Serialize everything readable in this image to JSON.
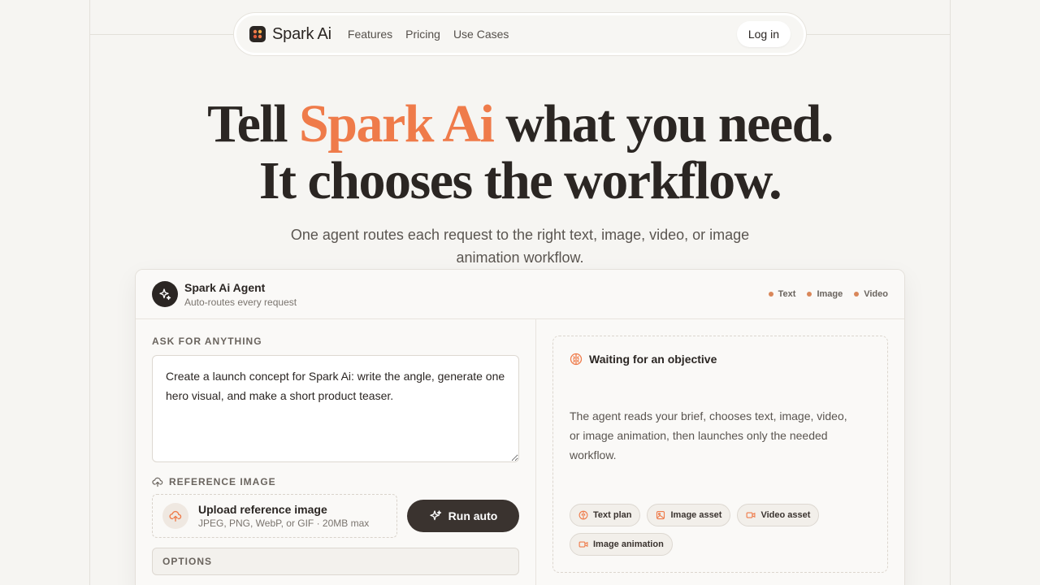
{
  "nav": {
    "brand": "Spark Ai",
    "links": [
      "Features",
      "Pricing",
      "Use Cases"
    ],
    "login": "Log in"
  },
  "hero": {
    "title_pre": "Tell ",
    "title_accent": "Spark Ai",
    "title_post": " what you need.",
    "title_line2": "It chooses the workflow.",
    "subtitle": "One agent routes each request to the right text, image, video, or image animation workflow."
  },
  "agent": {
    "name": "Spark Ai Agent",
    "subtitle": "Auto-routes every request",
    "tags": [
      "Text",
      "Image",
      "Video"
    ]
  },
  "form": {
    "ask_label": "ASK FOR ANYTHING",
    "prompt_value": "Create a launch concept for Spark Ai: write the angle, generate one hero visual, and make a short product teaser.",
    "ref_label": "REFERENCE IMAGE",
    "upload_title": "Upload reference image",
    "upload_hint": "JPEG, PNG, WebP, or GIF · 20MB max",
    "run_label": "Run auto",
    "options_label": "OPTIONS"
  },
  "status": {
    "title": "Waiting for an objective",
    "description": "The agent reads your brief, chooses text, image, video, or image animation, then launches only the needed workflow.",
    "chips": [
      "Text plan",
      "Image asset",
      "Video asset",
      "Image animation"
    ]
  },
  "colors": {
    "accent": "#ef7b4a",
    "dark": "#2b2623",
    "background": "#f6f5f2"
  }
}
